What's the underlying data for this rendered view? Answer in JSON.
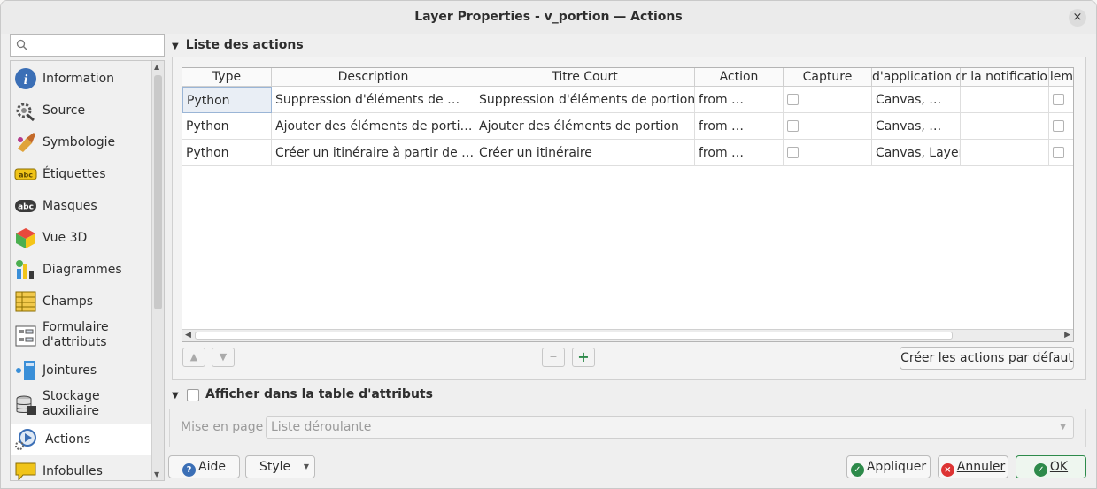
{
  "window": {
    "title": "Layer Properties - v_portion — Actions",
    "close_glyph": "×"
  },
  "search": {
    "placeholder": ""
  },
  "sidebar": {
    "items": [
      {
        "label": "Information",
        "icon": "info-icon"
      },
      {
        "label": "Source",
        "icon": "source-icon"
      },
      {
        "label": "Symbologie",
        "icon": "symbology-icon"
      },
      {
        "label": "Étiquettes",
        "icon": "labels-icon",
        "badge": "abc"
      },
      {
        "label": "Masques",
        "icon": "masks-icon",
        "badge": "abc"
      },
      {
        "label": "Vue 3D",
        "icon": "3d-view-icon"
      },
      {
        "label": "Diagrammes",
        "icon": "diagrams-icon"
      },
      {
        "label": "Champs",
        "icon": "fields-icon"
      },
      {
        "label": "Formulaire\nd'attributs",
        "line1": "Formulaire",
        "line2": "d'attributs",
        "icon": "attributes-form-icon"
      },
      {
        "label": "Jointures",
        "icon": "joins-icon"
      },
      {
        "label": "Stockage\nauxiliaire",
        "line1": "Stockage",
        "line2": "auxiliaire",
        "icon": "auxiliary-storage-icon"
      },
      {
        "label": "Actions",
        "icon": "actions-icon",
        "active": true
      },
      {
        "label": "Infobulles",
        "icon": "tooltips-icon"
      }
    ]
  },
  "actions_section": {
    "title": "Liste des actions"
  },
  "table": {
    "columns": [
      "Type",
      "Description",
      "Titre Court",
      "Action",
      "Capture",
      "d'application d",
      "r la notificatio",
      "lem"
    ],
    "rows": [
      {
        "type": "Python",
        "description": "Suppression d'éléments de …",
        "short_title": "Suppression d'éléments de portion",
        "action": "from …",
        "capture": false,
        "scopes": "Canvas, …",
        "notification": "",
        "checked_last": false
      },
      {
        "type": "Python",
        "description": "Ajouter des éléments de porti…",
        "short_title": "Ajouter des éléments de portion",
        "action": "from …",
        "capture": false,
        "scopes": "Canvas, …",
        "notification": "",
        "checked_last": false
      },
      {
        "type": "Python",
        "description": "Créer un itinéraire à partir de …",
        "short_title": "Créer un itinéraire",
        "action": "from …",
        "capture": false,
        "scopes": "Canvas, Layer",
        "notification": "",
        "checked_last": false
      }
    ]
  },
  "buttons": {
    "move_up": "▲",
    "move_down": "▼",
    "remove": "−",
    "add": "+",
    "create_defaults": "Créer les actions par défaut",
    "help": "Aide",
    "style": "Style",
    "apply": "Appliquer",
    "cancel": "Annuler",
    "ok": "OK"
  },
  "attribute_table_section": {
    "title": "Afficher dans la table d'attributs",
    "checked": false
  },
  "layout": {
    "label": "Mise en page",
    "value": "Liste déroulante"
  },
  "colors": {
    "accent_green": "#2d8a4a",
    "info_blue": "#3b6fb6",
    "cancel_red": "#d33"
  }
}
